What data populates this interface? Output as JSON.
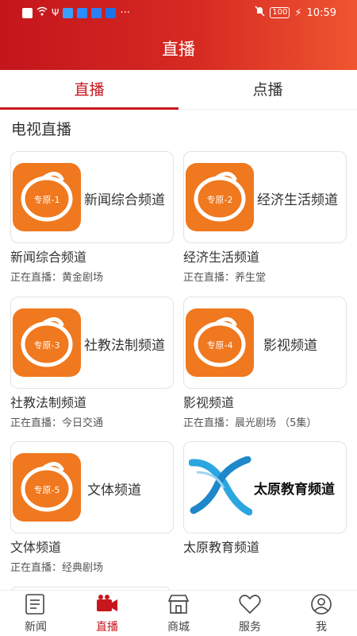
{
  "status_bar": {
    "time": "10:59",
    "battery": "100",
    "dots": "···"
  },
  "header": {
    "title": "直播"
  },
  "tabs": [
    {
      "label": "直播"
    },
    {
      "label": "点播"
    }
  ],
  "section": {
    "title": "电视直播"
  },
  "channels": [
    {
      "logo_text": "专原-1",
      "thumb_title": "新闻综合频道",
      "name": "新闻综合频道",
      "live": "正在直播：黄金剧场"
    },
    {
      "logo_text": "专原-2",
      "thumb_title": "经济生活频道",
      "name": "经济生活频道",
      "live": "正在直播：养生堂"
    },
    {
      "logo_text": "专原-3",
      "thumb_title": "社教法制频道",
      "name": "社教法制频道",
      "live": "正在直播：今日交通"
    },
    {
      "logo_text": "专原-4",
      "thumb_title": "影视频道",
      "name": "影视频道",
      "live": "正在直播：晨光剧场 （5集）"
    },
    {
      "logo_text": "专原-5",
      "thumb_title": "文体频道",
      "name": "文体频道",
      "live": "正在直播：经典剧场"
    },
    {
      "logo_text": "",
      "thumb_title": "太原教育频道",
      "name": "太原教育频道",
      "live": ""
    }
  ],
  "bottom_nav": [
    {
      "label": "新闻",
      "icon": "newspaper-icon"
    },
    {
      "label": "直播",
      "icon": "live-camera-icon"
    },
    {
      "label": "商城",
      "icon": "store-icon"
    },
    {
      "label": "服务",
      "icon": "heart-icon"
    },
    {
      "label": "我",
      "icon": "profile-icon"
    }
  ],
  "colors": {
    "brand": "#c8161d",
    "logo_orange": "#f0781e"
  }
}
